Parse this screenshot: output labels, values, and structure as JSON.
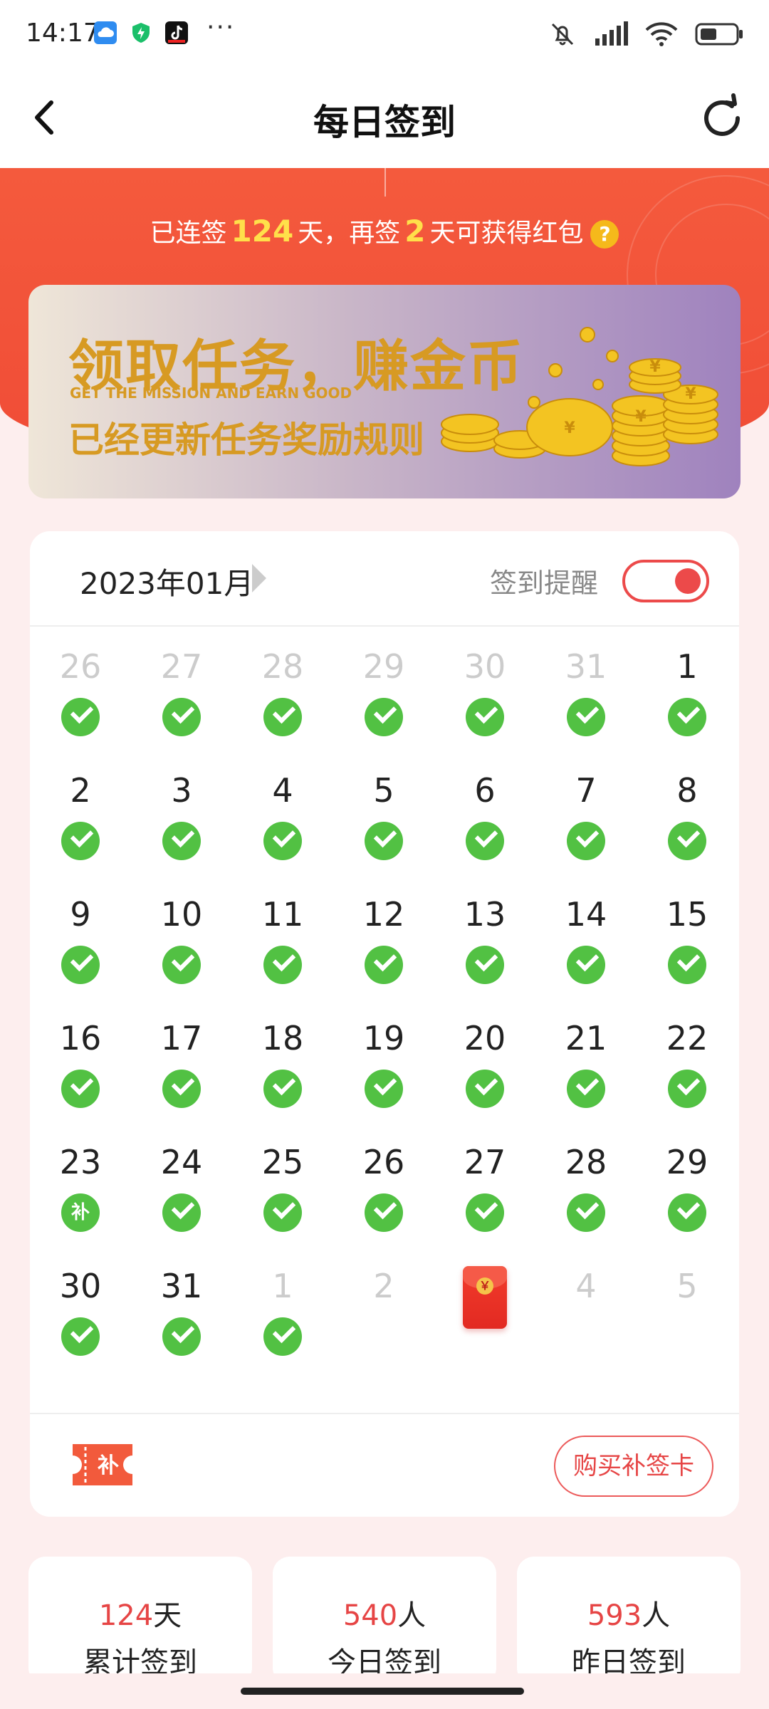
{
  "status_bar": {
    "time": "14:17",
    "icons_left": [
      "cloud-app-icon",
      "shield-app-icon",
      "tiktok-app-icon"
    ],
    "more": "···",
    "icons_right": [
      "mute-bell-icon",
      "signal-icon",
      "wifi-icon",
      "battery-icon"
    ]
  },
  "header": {
    "title": "每日签到",
    "back_icon": "chevron-left-icon",
    "refresh_icon": "refresh-icon"
  },
  "hero": {
    "streak_prefix": "已连签",
    "streak_days": "124",
    "streak_mid": "天，再签",
    "remaining_days": "2",
    "streak_suffix": "天可获得红包",
    "help": "?"
  },
  "banner": {
    "title": "领取任务，赚金币",
    "subtitle": "GET THE MISSION AND EARN GOOD",
    "desc": "已经更新任务奖励规则"
  },
  "calendar": {
    "month": "2023年01月",
    "reminder_label": "签到提醒",
    "reminder_on": true,
    "weeks": [
      [
        {
          "d": "26",
          "dim": true,
          "mark": "check"
        },
        {
          "d": "27",
          "dim": true,
          "mark": "check"
        },
        {
          "d": "28",
          "dim": true,
          "mark": "check"
        },
        {
          "d": "29",
          "dim": true,
          "mark": "check"
        },
        {
          "d": "30",
          "dim": true,
          "mark": "check"
        },
        {
          "d": "31",
          "dim": true,
          "mark": "check"
        },
        {
          "d": "1",
          "dim": false,
          "mark": "check"
        }
      ],
      [
        {
          "d": "2",
          "dim": false,
          "mark": "check"
        },
        {
          "d": "3",
          "dim": false,
          "mark": "check"
        },
        {
          "d": "4",
          "dim": false,
          "mark": "check"
        },
        {
          "d": "5",
          "dim": false,
          "mark": "check"
        },
        {
          "d": "6",
          "dim": false,
          "mark": "check"
        },
        {
          "d": "7",
          "dim": false,
          "mark": "check"
        },
        {
          "d": "8",
          "dim": false,
          "mark": "check"
        }
      ],
      [
        {
          "d": "9",
          "dim": false,
          "mark": "check"
        },
        {
          "d": "10",
          "dim": false,
          "mark": "check"
        },
        {
          "d": "11",
          "dim": false,
          "mark": "check"
        },
        {
          "d": "12",
          "dim": false,
          "mark": "check"
        },
        {
          "d": "13",
          "dim": false,
          "mark": "check"
        },
        {
          "d": "14",
          "dim": false,
          "mark": "check"
        },
        {
          "d": "15",
          "dim": false,
          "mark": "check"
        }
      ],
      [
        {
          "d": "16",
          "dim": false,
          "mark": "check"
        },
        {
          "d": "17",
          "dim": false,
          "mark": "check"
        },
        {
          "d": "18",
          "dim": false,
          "mark": "check"
        },
        {
          "d": "19",
          "dim": false,
          "mark": "check"
        },
        {
          "d": "20",
          "dim": false,
          "mark": "check"
        },
        {
          "d": "21",
          "dim": false,
          "mark": "check"
        },
        {
          "d": "22",
          "dim": false,
          "mark": "check"
        }
      ],
      [
        {
          "d": "23",
          "dim": false,
          "mark": "makeup",
          "mark_text": "补"
        },
        {
          "d": "24",
          "dim": false,
          "mark": "check"
        },
        {
          "d": "25",
          "dim": false,
          "mark": "check"
        },
        {
          "d": "26",
          "dim": false,
          "mark": "check"
        },
        {
          "d": "27",
          "dim": false,
          "mark": "check"
        },
        {
          "d": "28",
          "dim": false,
          "mark": "check"
        },
        {
          "d": "29",
          "dim": false,
          "mark": "check"
        }
      ],
      [
        {
          "d": "30",
          "dim": false,
          "mark": "check"
        },
        {
          "d": "31",
          "dim": false,
          "mark": "check"
        },
        {
          "d": "1",
          "dim": true,
          "mark": "check"
        },
        {
          "d": "2",
          "dim": true,
          "mark": "none"
        },
        {
          "d": "",
          "dim": true,
          "mark": "redpack",
          "mark_text": "￥"
        },
        {
          "d": "4",
          "dim": true,
          "mark": "none"
        },
        {
          "d": "5",
          "dim": true,
          "mark": "none"
        }
      ]
    ],
    "makeup_card_icon_text": "补",
    "buy_button": "购买补签卡"
  },
  "stats": [
    {
      "value": "124",
      "unit": "天",
      "label": "累计签到"
    },
    {
      "value": "540",
      "unit": "人",
      "label": "今日签到"
    },
    {
      "value": "593",
      "unit": "人",
      "label": "昨日签到"
    }
  ],
  "colors": {
    "hero_red": "#f04c36",
    "accent_yellow": "#ffe04a",
    "check_green": "#52c143",
    "text_red": "#e64545",
    "banner_gold": "#d79a23"
  }
}
